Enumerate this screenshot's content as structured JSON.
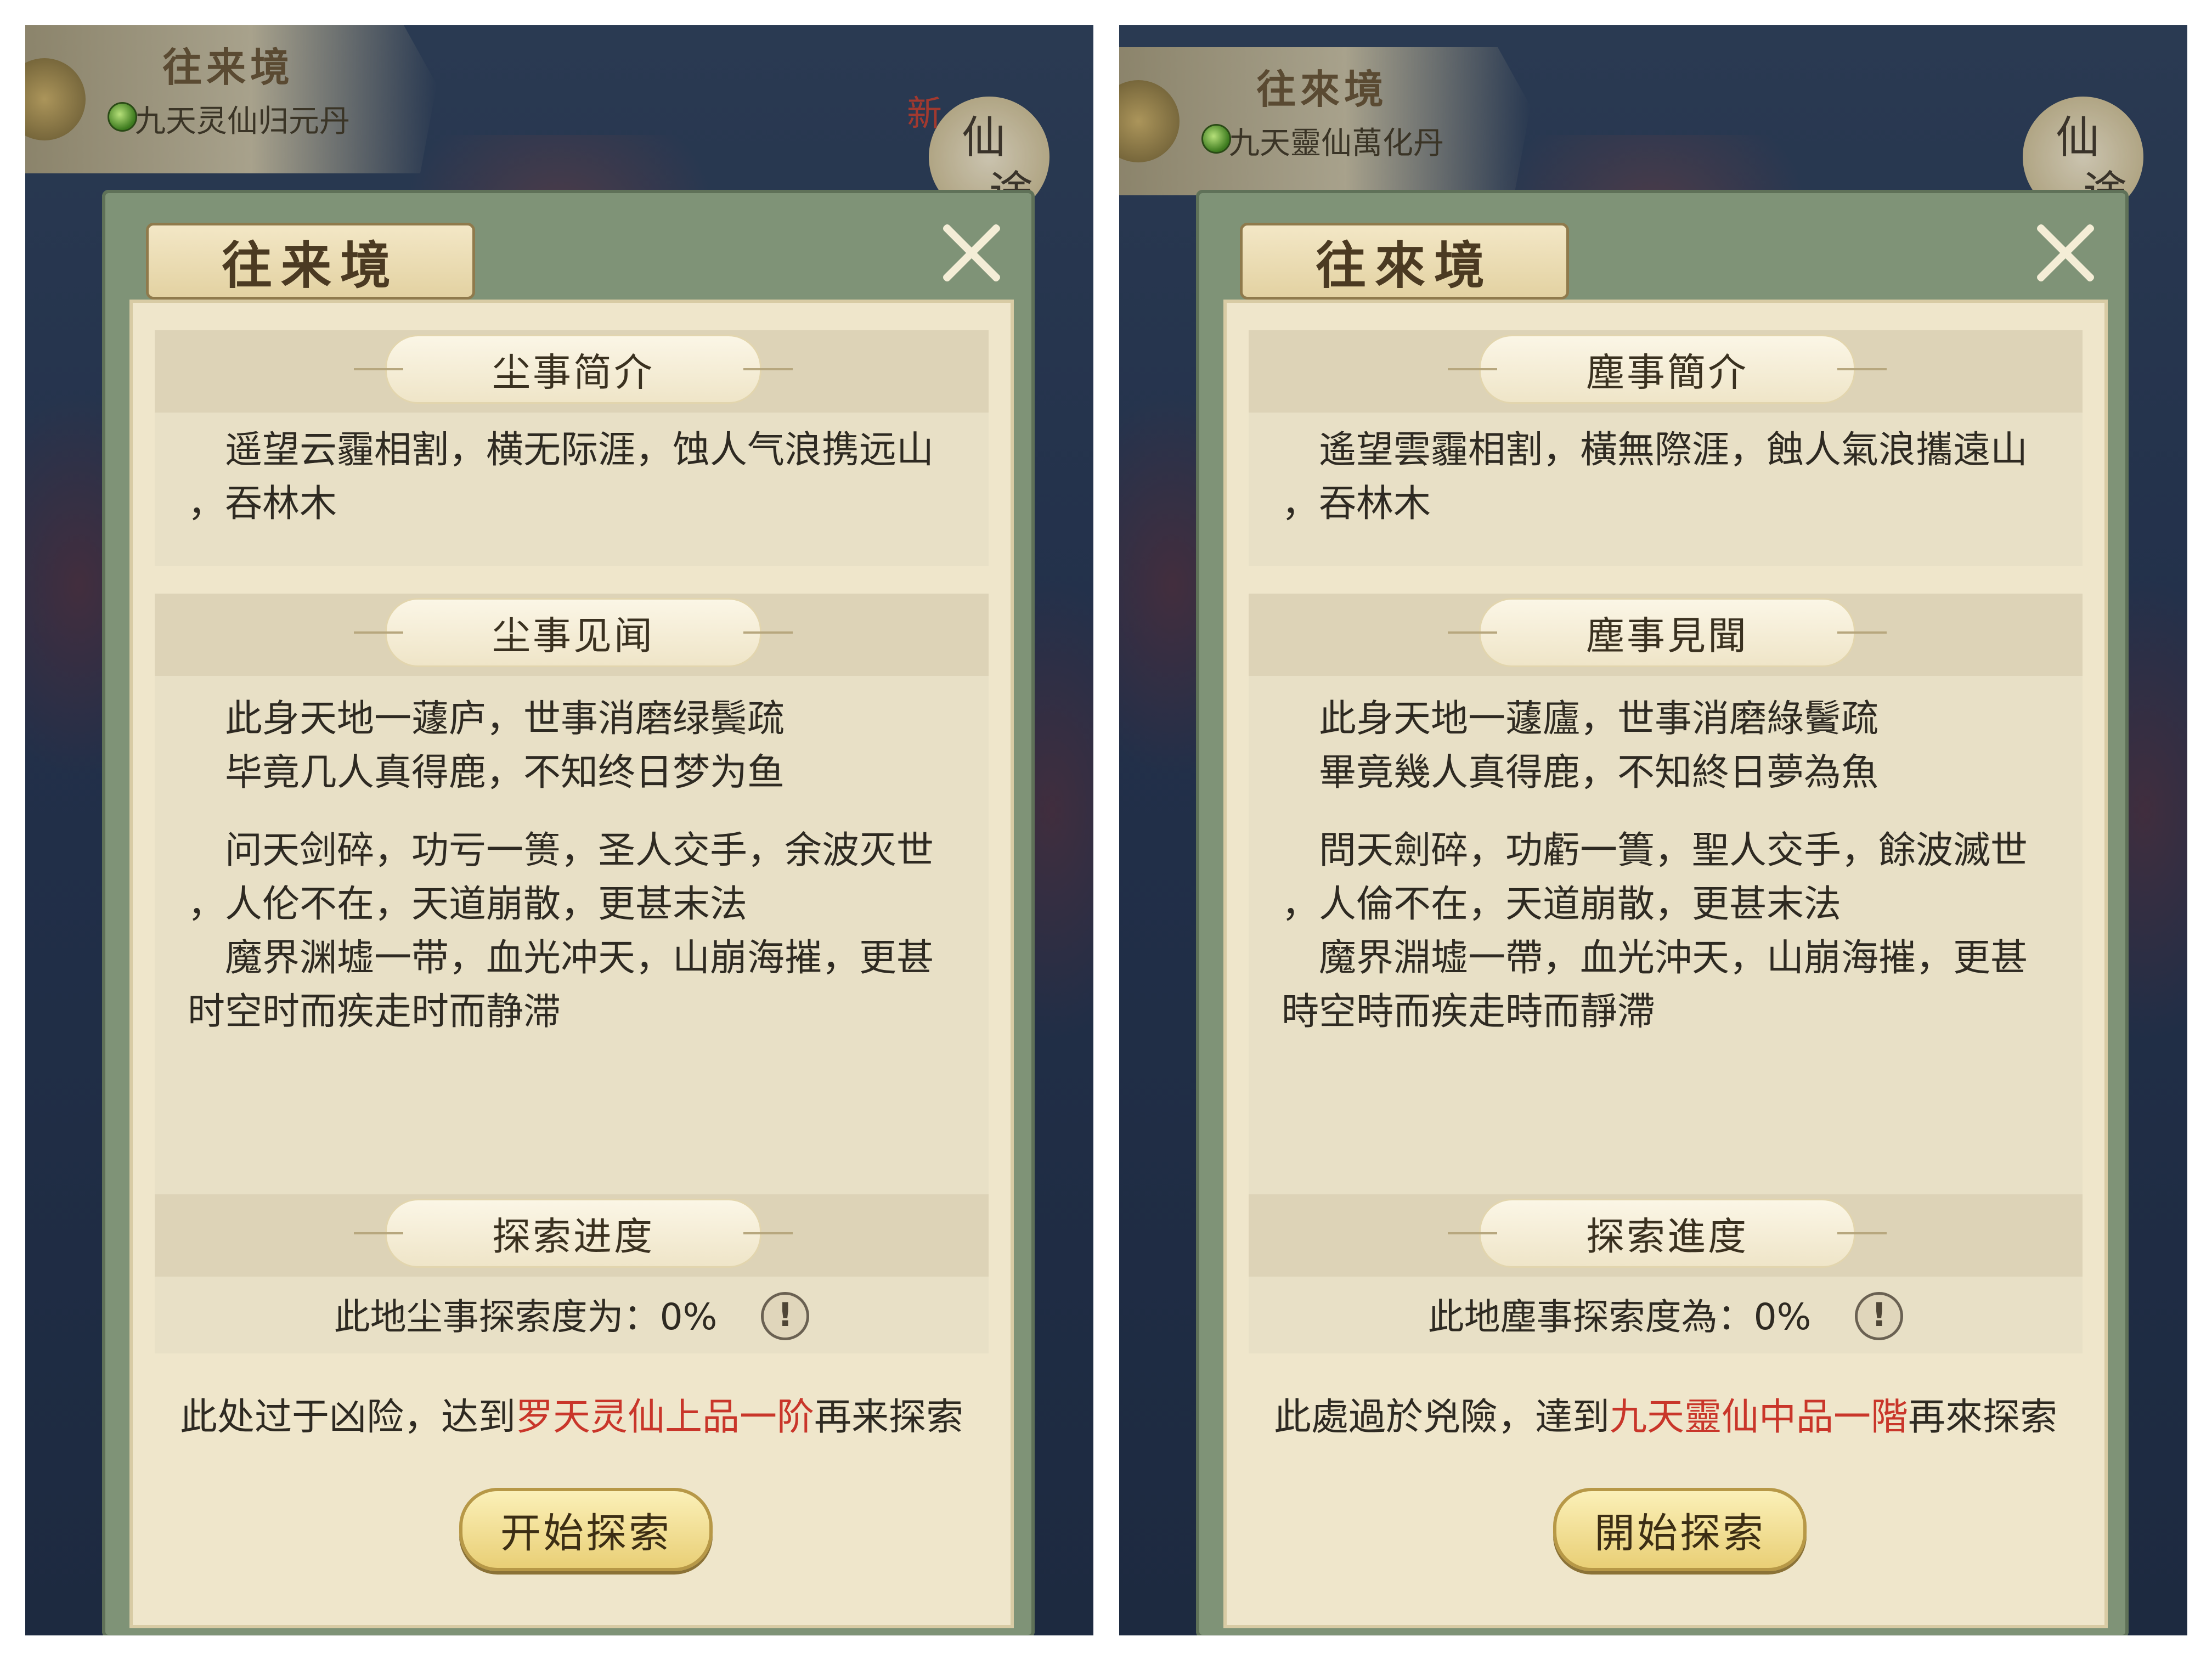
{
  "screens": [
    {
      "banner": {
        "title": "往来境",
        "item": "九天灵仙归元丹"
      },
      "logo": {
        "chars": [
          "新",
          "仙",
          "途"
        ]
      },
      "panel": {
        "title": "往来境",
        "intro_header": "尘事简介",
        "intro_text": "　遥望云霾相割，横无际涯，蚀人气浪携远山\n，吞林木",
        "lore_header": "尘事见闻",
        "lore_p1": "　此身天地一蘧庐，世事消磨绿鬓疏\n　毕竟几人真得鹿，不知终日梦为鱼",
        "lore_p2": "　问天剑碎，功亏一篑，圣人交手，余波灭世\n，人伦不在，天道崩散，更甚末法\n　魔界渊墟一带，血光冲天，山崩海摧，更甚\n时空时而疾走时而静滞",
        "progress_header": "探索进度",
        "progress_text": "此地尘事探索度为：0%",
        "warn_prefix": "此处过于凶险，达到",
        "warn_req": "罗天灵仙上品一阶",
        "warn_suffix": "再来探索",
        "button": "开始探索"
      }
    },
    {
      "banner": {
        "title": "往來境",
        "item": "九天靈仙萬化丹"
      },
      "logo": {
        "chars": [
          "仙",
          "途"
        ]
      },
      "panel": {
        "title": "往來境",
        "intro_header": "塵事簡介",
        "intro_text": "　遙望雲霾相割，橫無際涯，蝕人氣浪攜遠山\n，吞林木",
        "lore_header": "塵事見聞",
        "lore_p1": "　此身天地一蘧廬，世事消磨綠鬢疏\n　畢竟幾人真得鹿，不知終日夢為魚",
        "lore_p2": "　問天劍碎，功虧一簣，聖人交手，餘波滅世\n，人倫不在，天道崩散，更甚末法\n　魔界淵墟一帶，血光沖天，山崩海摧，更甚\n時空時而疾走時而靜滯",
        "progress_header": "探索進度",
        "progress_text": "此地塵事探索度為：0%",
        "warn_prefix": "此處過於兇險，達到",
        "warn_req": "九天靈仙中品一階",
        "warn_suffix": "再來探索",
        "button": "開始探索"
      }
    }
  ],
  "colors": {
    "panel_frame": "#7f9377",
    "parchment": "#efe6cb",
    "requirement": "#c9362a",
    "button": "#e9cf76"
  }
}
